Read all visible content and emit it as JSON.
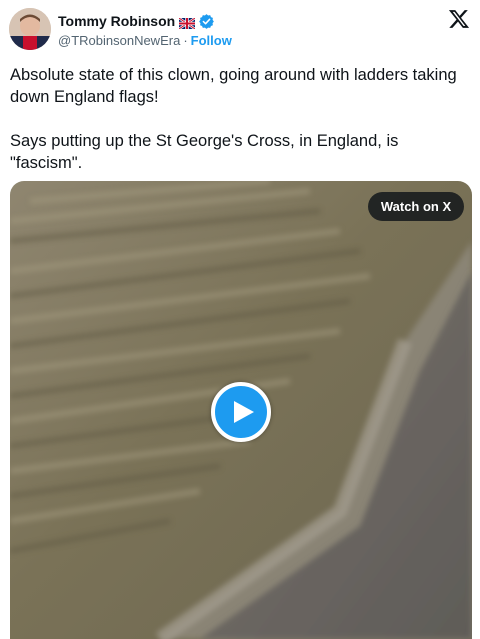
{
  "author": {
    "display_name": "Tommy Robinson",
    "handle": "@TRobinsonNewEra",
    "separator": "·",
    "follow_label": "Follow",
    "flag_icon": "uk-flag-icon",
    "verified_icon": "verified-badge-icon"
  },
  "tweet": {
    "paragraphs": [
      "Absolute state of this clown, going around with ladders taking down England flags!",
      "Says putting up the St George's Cross, in England, is \"fascism\"."
    ]
  },
  "media": {
    "watch_label": "Watch on X",
    "play_icon": "play-icon"
  },
  "icons": {
    "logo": "x-logo-icon"
  },
  "colors": {
    "accent": "#1d9bf0",
    "text": "#0f1419",
    "secondary_text": "#536471"
  }
}
